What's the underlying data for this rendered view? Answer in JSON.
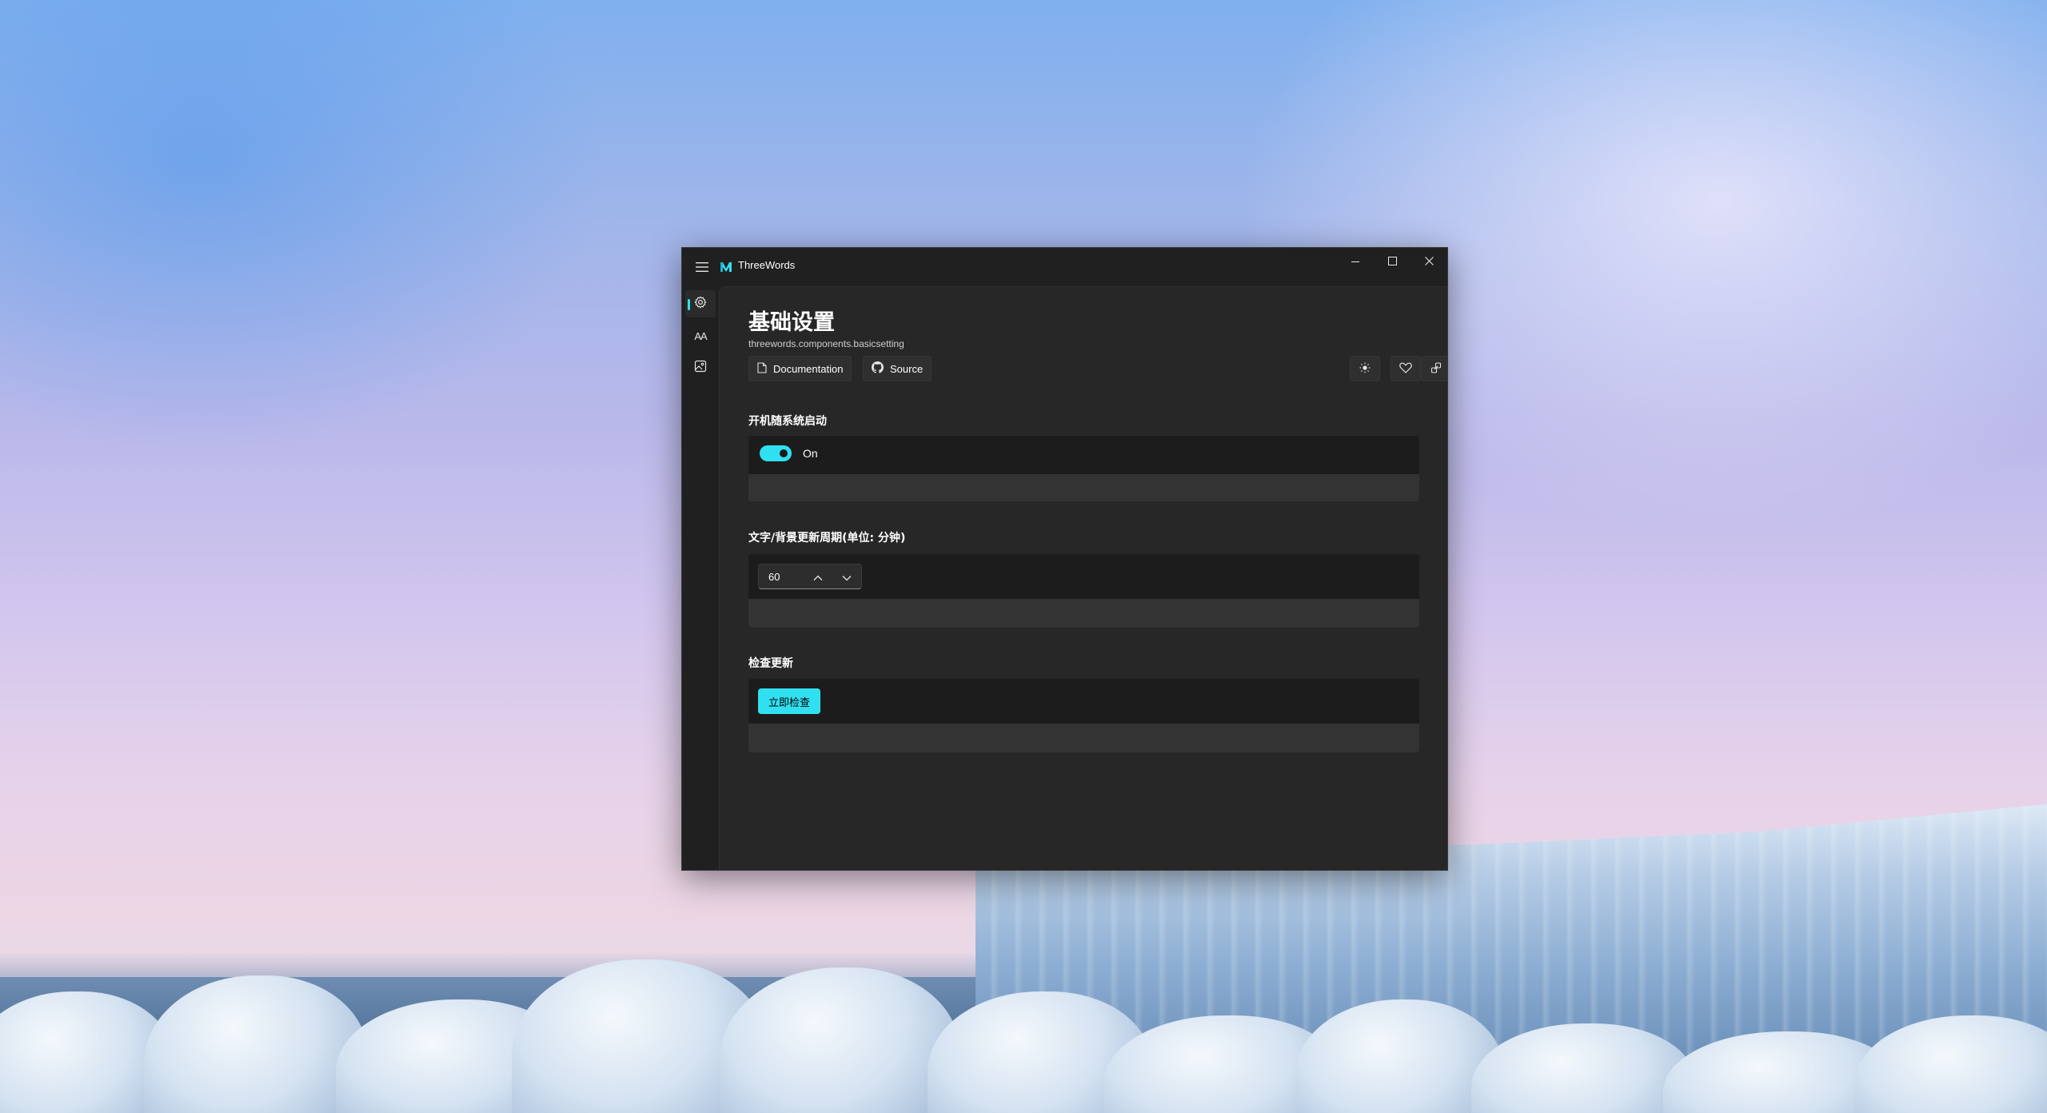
{
  "window": {
    "app_title": "ThreeWords",
    "accent_color": "#31e0f0"
  },
  "icons": {
    "menu": "hamburger-icon",
    "logo": "threewords-logo-icon",
    "minimize": "minimize-icon",
    "maximize": "maximize-icon",
    "close": "close-icon",
    "nav_settings": "gear-icon",
    "nav_font": "font-size-icon",
    "nav_image": "image-icon",
    "documentation": "document-icon",
    "source": "github-icon",
    "theme": "brightness-icon",
    "favorite": "heart-icon",
    "link": "link-icon",
    "spin_up": "chevron-up-icon",
    "spin_down": "chevron-down-icon"
  },
  "nav": {
    "items": [
      {
        "id": "settings",
        "label": "",
        "active": true
      },
      {
        "id": "font",
        "label": "AA"
      },
      {
        "id": "image",
        "label": ""
      }
    ]
  },
  "page": {
    "title": "基础设置",
    "subtitle": "threewords.components.basicsetting",
    "doc_label": "Documentation",
    "source_label": "Source"
  },
  "sections": {
    "autostart": {
      "title": "开机随系统启动",
      "toggle_state_label": "On",
      "toggle_on": true
    },
    "interval": {
      "title": "文字/背景更新周期(单位: 分钟)",
      "value": "60"
    },
    "update": {
      "title": "检查更新",
      "button_label": "立即检查"
    }
  }
}
